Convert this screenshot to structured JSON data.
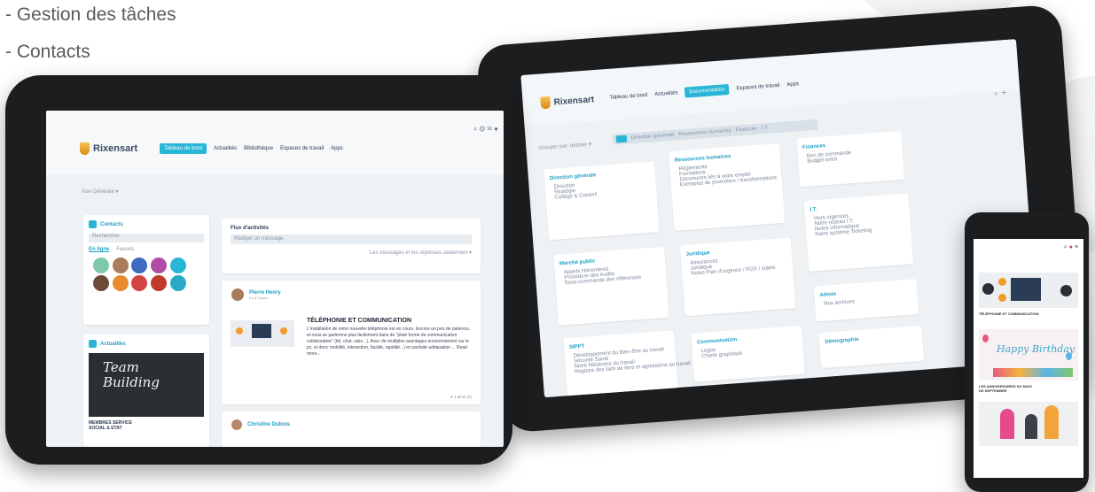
{
  "bullets": [
    "- Gestion des tâches",
    "- Contacts"
  ],
  "brand": "Rixensart",
  "colors": {
    "accent": "#29b6d6",
    "accent_dark": "#1f9fc2",
    "bezel": "#1c1d1f",
    "bg": "#ffffff",
    "text": "#5b5b5b"
  },
  "tablet_left": {
    "nav": [
      "Tableau de bord",
      "Actualités",
      "Bibliothèque",
      "Espaces de travail",
      "Apps"
    ],
    "active_nav": "Tableau de bord",
    "filter_label": "Vue Générale ▾",
    "contacts_title": "Contacts",
    "contacts_search": "Rechercher",
    "contacts_tabs": [
      "En ligne",
      "Favoris"
    ],
    "actualites_title": "Actualités",
    "team_image_text": "Team Building",
    "news_caption": "MEMBRES SERVICE SOCIAL & ETAT",
    "feed_title": "Flux d'activités",
    "feed_input": "Rédiger un message",
    "feed_filter": "Les messages et les réponses seulement ▾",
    "post_author": "Pierre Henry",
    "post_time": "il y a 3 jours",
    "post_title": "TÉLÉPHONIE ET COMMUNICATION",
    "post_body": "L'installation de notre nouvelle téléphonie est en cours. Encore un peu de patience, et nous se parlerons plus facilement dans de \"plate forme de communication collaborative\" (tél, chat, visio...). Avec de multiples avantages environnement sur le pc, et donc mobilité, interaction, facilité, rapidité...) en parfaite adéquation ... Read more...",
    "post_likes": "♥ 1 aime (s)",
    "comment_author": "Christine Dubois"
  },
  "tablet_right": {
    "nav": [
      "Tableau de bord",
      "Actualités",
      "Documentation",
      "Espaces de travail",
      "Apps"
    ],
    "active_nav": "Documentation",
    "group_label": "Grouper par: dossier ▾",
    "breadcrumb": [
      "Direction générale",
      "Ressources humaines",
      "Finances",
      "I.T."
    ],
    "cards": [
      {
        "title": "Direction générale",
        "items": [
          "Direction",
          "Stratégie",
          "Collège & Conseil"
        ]
      },
      {
        "title": "Ressources humaines",
        "items": [
          "Règlements",
          "Formations",
          "Documents liés à votre emploi",
          "Exemples de promotion / transformations"
        ]
      },
      {
        "title": "Finances",
        "items": [
          "Bon de commande",
          "Budget extra"
        ]
      },
      {
        "title": "Marché public",
        "items": [
          "Appels Hansmères",
          "Procédure des Audits",
          "Sous-commande des références"
        ]
      },
      {
        "title": "Juridique",
        "items": [
          "Assurances",
          "Juridique",
          "Notes Plan d'urgence / PGS / sujets"
        ]
      },
      {
        "title": "I.T.",
        "items": [
          "Hors urgences",
          "Notre réseau I.T.",
          "Notes informatique",
          "Notre système Ticketing"
        ]
      },
      {
        "title": "SIPPT",
        "items": [
          "Développement du Bien-être au travail",
          "Sécurité Santé",
          "Notre Médecine du travail",
          "Registre des faits de tiers et agressions au travail"
        ]
      },
      {
        "title": "Communication",
        "items": [
          "Logos",
          "Charte graphique"
        ]
      },
      {
        "title": "Admin",
        "items": [
          "Nos archives"
        ]
      },
      {
        "title": "Démographie",
        "items": []
      }
    ]
  },
  "phone": {
    "post1_title": "TÉLÉPHONIE ET COMMUNICATION",
    "birthday_text": "Happy Birthday",
    "post2_title": "LES ANNIVERSAIRES DU MOIS DE SEPTEMBRE"
  }
}
